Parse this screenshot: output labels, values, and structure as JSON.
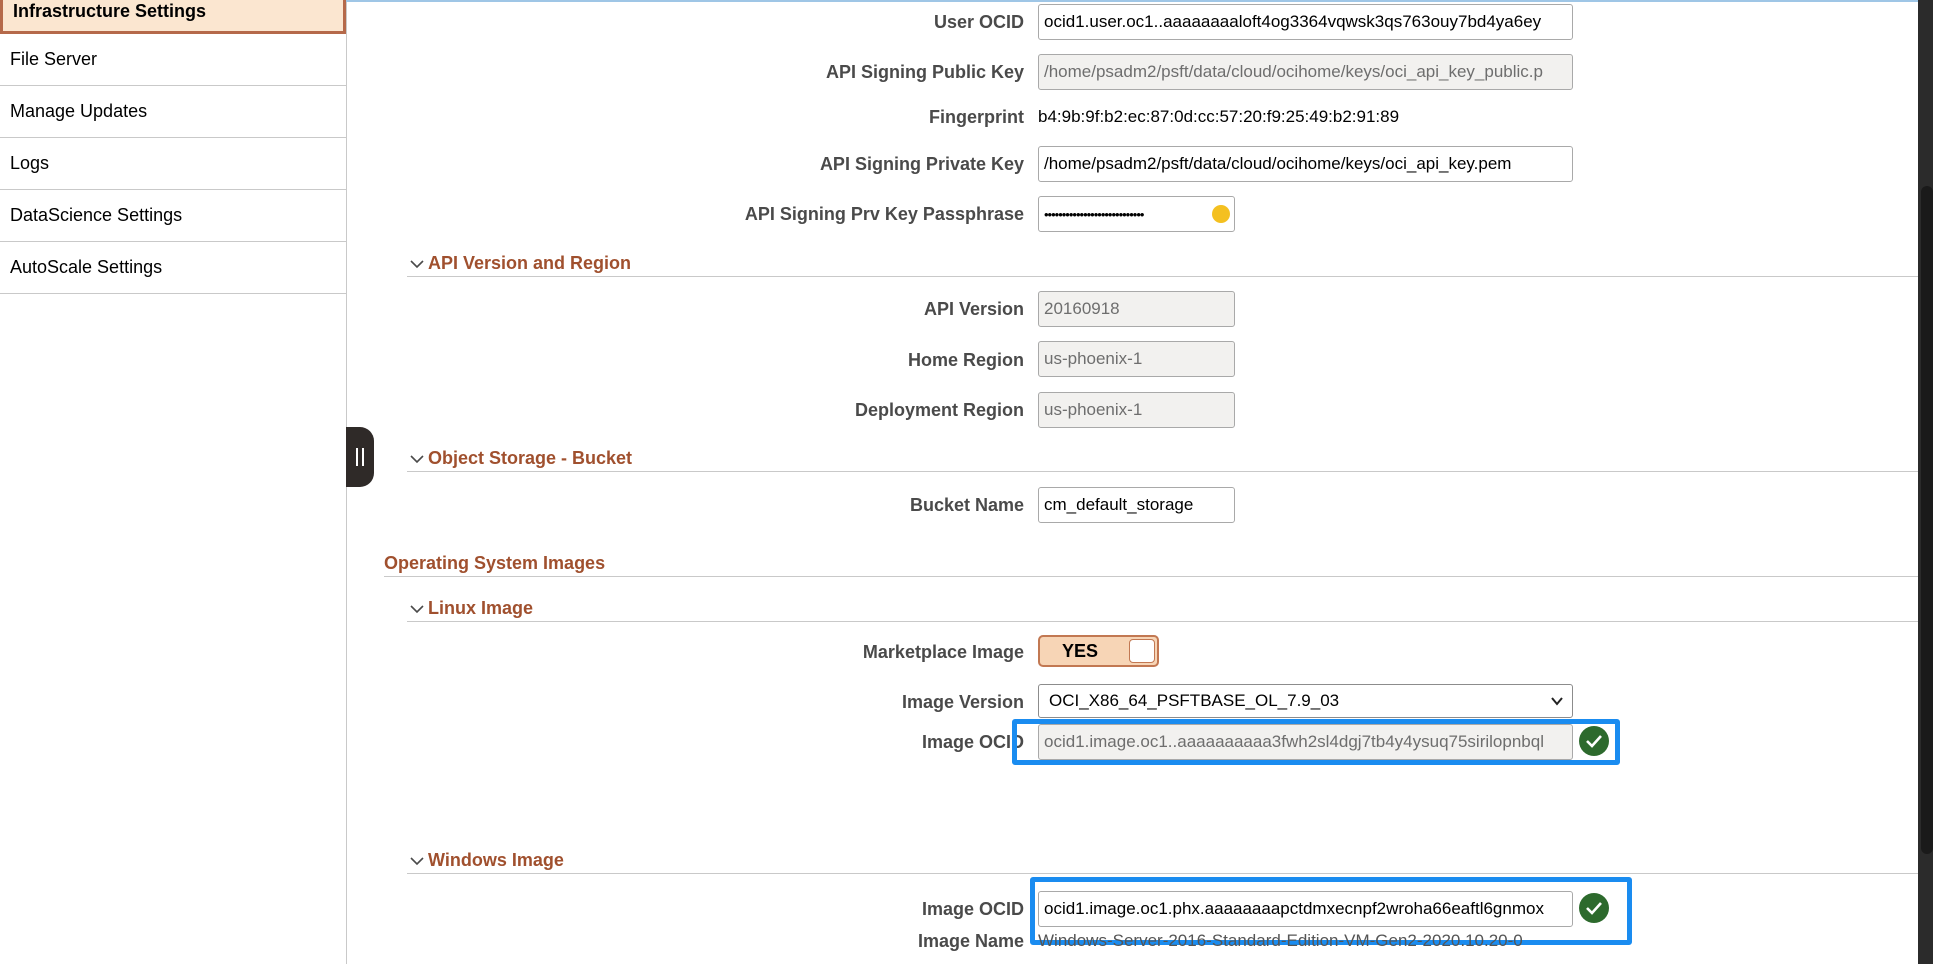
{
  "sidebar": {
    "active": "Infrastructure Settings",
    "items": [
      {
        "label": "File Server"
      },
      {
        "label": "Manage Updates"
      },
      {
        "label": "Logs"
      },
      {
        "label": "DataScience Settings"
      },
      {
        "label": "AutoScale Settings"
      }
    ]
  },
  "fields": {
    "user_ocid": {
      "label": "User OCID",
      "value": "ocid1.user.oc1..aaaaaaaaloft4og3364vqwsk3qs763ouy7bd4ya6ey"
    },
    "api_public_key": {
      "label": "API Signing Public Key",
      "value": "/home/psadm2/psft/data/cloud/ocihome/keys/oci_api_key_public.p"
    },
    "fingerprint": {
      "label": "Fingerprint",
      "value": "b4:9b:9f:b2:ec:87:0d:cc:57:20:f9:25:49:b2:91:89"
    },
    "api_private_key": {
      "label": "API Signing Private Key",
      "value": "/home/psadm2/psft/data/cloud/ocihome/keys/oci_api_key.pem"
    },
    "passphrase": {
      "label": "API Signing Prv Key Passphrase",
      "value": "••••••••••••••••••••••••••••"
    }
  },
  "api_section": {
    "title": "API Version and Region",
    "api_version": {
      "label": "API Version",
      "value": "20160918"
    },
    "home_region": {
      "label": "Home Region",
      "value": "us-phoenix-1"
    },
    "deployment_region": {
      "label": "Deployment Region",
      "value": "us-phoenix-1"
    }
  },
  "bucket_section": {
    "title": "Object Storage - Bucket",
    "bucket_name": {
      "label": "Bucket Name",
      "value": "cm_default_storage"
    }
  },
  "os_images": {
    "title": "Operating System Images",
    "linux": {
      "title": "Linux Image",
      "marketplace_label": "Marketplace Image",
      "marketplace_value": "YES",
      "image_version_label": "Image Version",
      "image_version_value": "OCI_X86_64_PSFTBASE_OL_7.9_03",
      "image_ocid_label": "Image OCID",
      "image_ocid_value": "ocid1.image.oc1..aaaaaaaaaa3fwh2sl4dgj7tb4y4ysuq75sirilopnbql"
    },
    "windows": {
      "title": "Windows Image",
      "image_ocid_label": "Image OCID",
      "image_ocid_value": "ocid1.image.oc1.phx.aaaaaaaapctdmxecnpf2wroha66eaftl6gnmox",
      "image_name_label": "Image Name",
      "image_name_value": "Windows-Server-2016-Standard-Edition-VM-Gen2-2020.10.20-0"
    }
  },
  "colors": {
    "accent": "#a0502e",
    "highlight": "#1a8cf0",
    "valid": "#2d6a2d"
  }
}
